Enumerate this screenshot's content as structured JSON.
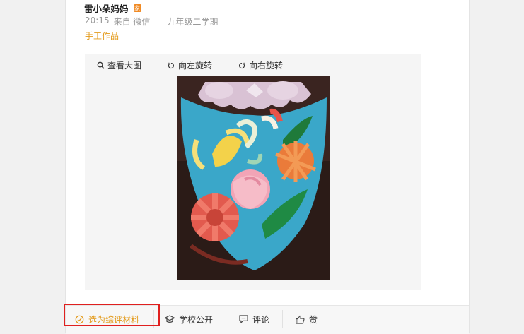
{
  "post": {
    "author": "雷小朵妈妈",
    "badge_icon": "parent-badge-icon",
    "time": "20:15",
    "source": "来自 微信",
    "grade": "九年级二学期",
    "tag": "手工作品"
  },
  "viewer": {
    "view_large": "查看大图",
    "rotate_left": "向左旋转",
    "rotate_right": "向右旋转"
  },
  "actions": {
    "select_material": "选为综评材料",
    "school_public": "学校公开",
    "comment": "评论",
    "like": "赞"
  },
  "colors": {
    "accent": "#e39a1a",
    "highlight": "#e0201f"
  }
}
